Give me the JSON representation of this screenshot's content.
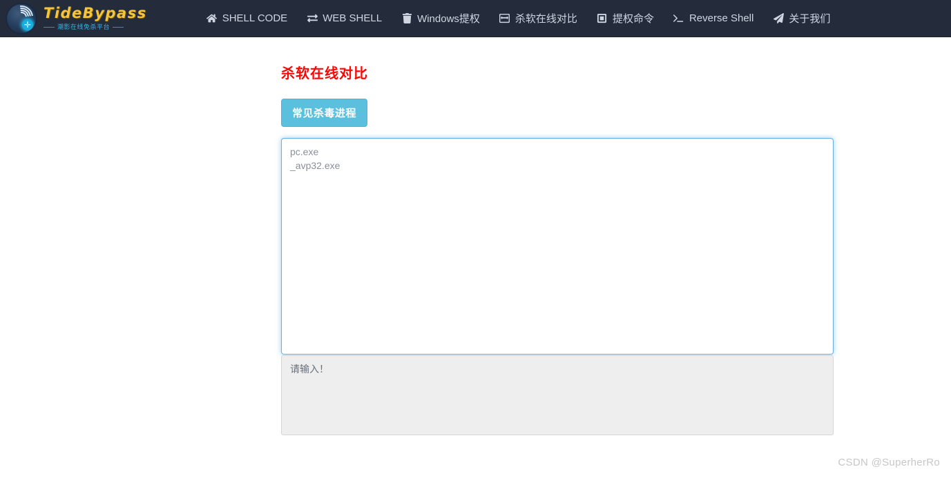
{
  "brand": {
    "title": "TideBypass",
    "subtitle": "潮影在线免杀平台",
    "logo_icon": "wave-shield-logo-icon"
  },
  "nav": {
    "items": [
      {
        "label": "SHELL CODE",
        "icon": "home-icon"
      },
      {
        "label": "WEB SHELL",
        "icon": "exchange-arrows-icon"
      },
      {
        "label": "Windows提权",
        "icon": "trash-icon"
      },
      {
        "label": "杀软在线对比",
        "icon": "arrows-left-right-box-icon"
      },
      {
        "label": "提权命令",
        "icon": "square-inset-icon"
      },
      {
        "label": "Reverse Shell",
        "icon": "terminal-prompt-icon"
      },
      {
        "label": "关于我们",
        "icon": "paper-plane-icon"
      }
    ]
  },
  "main": {
    "title": "杀软在线对比",
    "title_color": "#fb0505",
    "process_button": {
      "label": "常见杀毒进程",
      "color": "#5bc0de"
    },
    "input_textarea": {
      "value": "pc.exe\n_avp32.exe",
      "placeholder": ""
    },
    "result_textarea": {
      "value": "",
      "placeholder": "请输入！"
    }
  },
  "watermark": {
    "text": "CSDN @SuperherRo"
  }
}
